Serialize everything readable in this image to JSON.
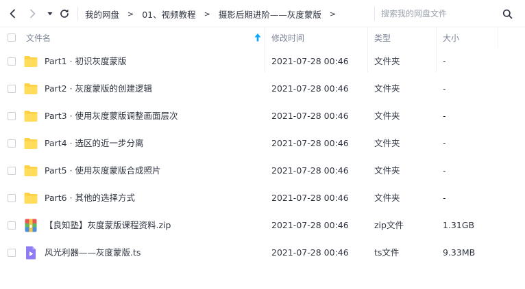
{
  "toolbar": {
    "back_icon": "chevron-left-icon",
    "forward_icon": "chevron-right-icon",
    "history_icon": "caret-down-icon",
    "refresh_icon": "refresh-icon",
    "breadcrumbs": [
      "我的网盘",
      "01、视频教程",
      "摄影后期进阶——灰度蒙版"
    ],
    "separator": ">",
    "search_placeholder": "搜索我的网盘文件",
    "search_icon": "search-icon"
  },
  "columns": {
    "name": "文件名",
    "modified": "修改时间",
    "type": "类型",
    "size": "大小",
    "sort_icon": "sort-up-arrow-icon"
  },
  "files": [
    {
      "name": "Part1 · 初识灰度蒙版",
      "modified": "2021-07-28 00:46",
      "type": "文件夹",
      "size": "-",
      "icon": "folder-icon"
    },
    {
      "name": "Part2 · 灰度蒙版的创建逻辑",
      "modified": "2021-07-28 00:46",
      "type": "文件夹",
      "size": "-",
      "icon": "folder-icon"
    },
    {
      "name": "Part3 · 使用灰度蒙版调整画面层次",
      "modified": "2021-07-28 00:46",
      "type": "文件夹",
      "size": "-",
      "icon": "folder-icon"
    },
    {
      "name": "Part4 · 选区的近一步分离",
      "modified": "2021-07-28 00:46",
      "type": "文件夹",
      "size": "-",
      "icon": "folder-icon"
    },
    {
      "name": "Part5 · 使用灰度蒙版合成照片",
      "modified": "2021-07-28 00:46",
      "type": "文件夹",
      "size": "-",
      "icon": "folder-icon"
    },
    {
      "name": "Part6 · 其他的选择方式",
      "modified": "2021-07-28 00:46",
      "type": "文件夹",
      "size": "-",
      "icon": "folder-icon"
    },
    {
      "name": "【良知塾】灰度蒙版课程资料.zip",
      "modified": "2021-07-28 00:46",
      "type": "zip文件",
      "size": "1.31GB",
      "icon": "zip-archive-icon"
    },
    {
      "name": "风光利器——灰度蒙版.ts",
      "modified": "2021-07-28 00:46",
      "type": "ts文件",
      "size": "9.33MB",
      "icon": "video-file-icon"
    }
  ],
  "colors": {
    "folder": "#ffd242",
    "accent": "#06a7ff",
    "video": "#8e7cf5",
    "text": "#2e3440",
    "muted": "#7b8394"
  }
}
